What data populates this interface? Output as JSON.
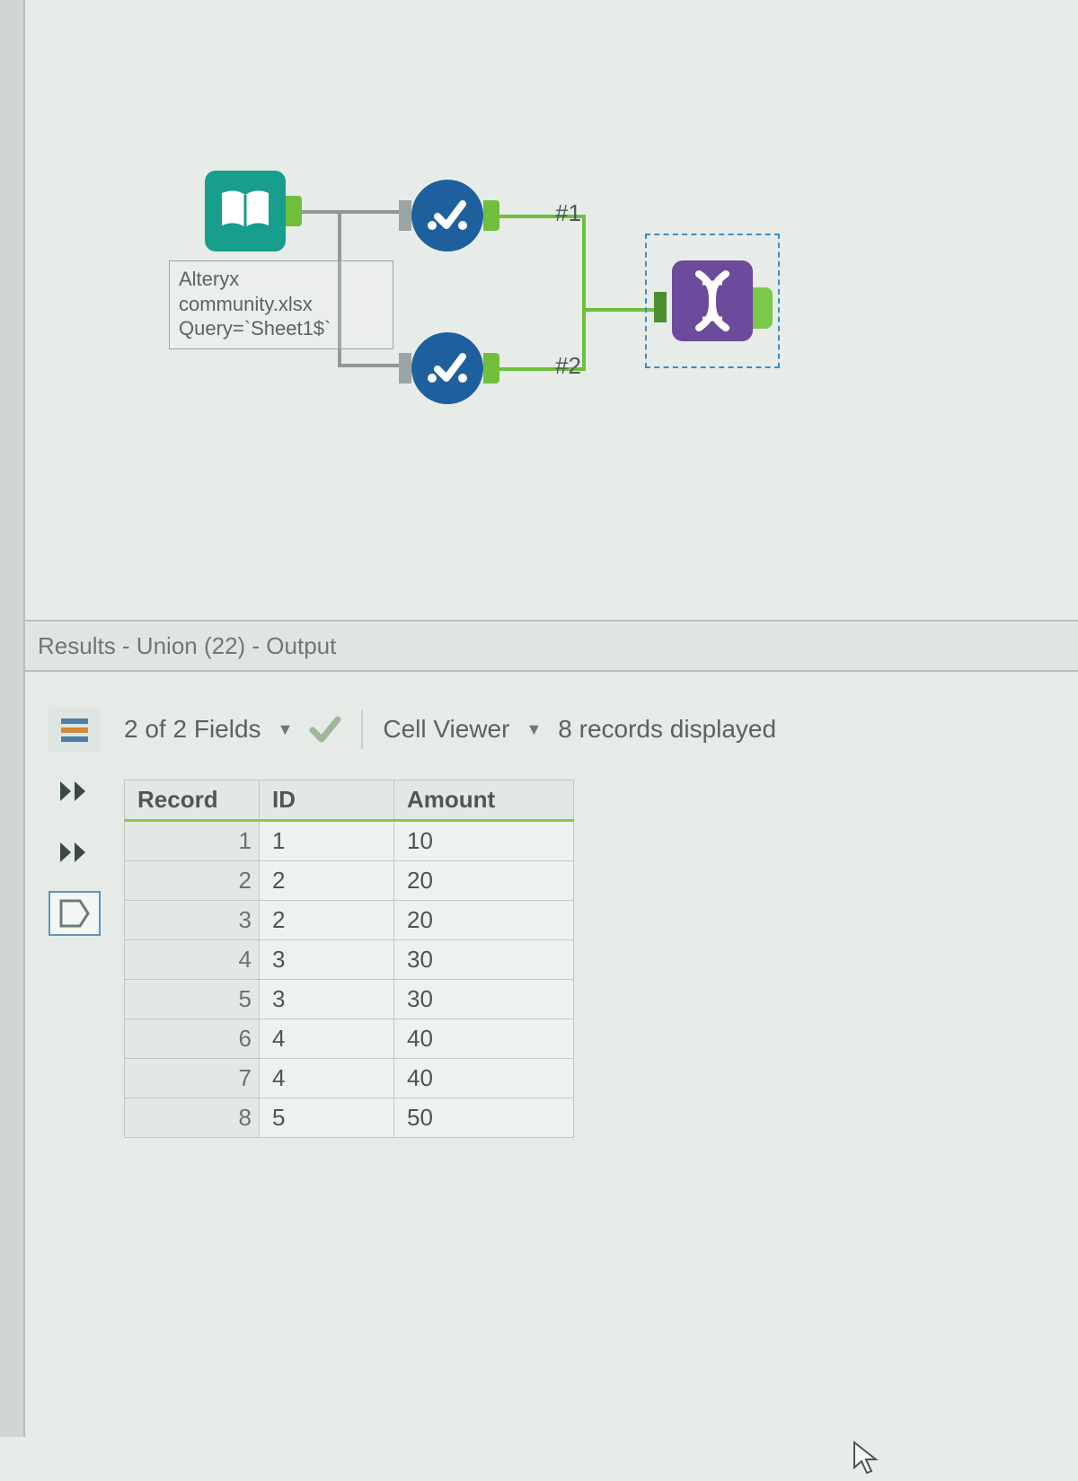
{
  "canvas": {
    "input_annotation": "Alteryx\ncommunity.xlsx\nQuery=`Sheet1$`",
    "branch1_label": "#1",
    "branch2_label": "#2"
  },
  "results": {
    "header": "Results - Union (22) - Output",
    "fields_label": "2 of 2 Fields",
    "cell_viewer_label": "Cell Viewer",
    "records_label": "8 records displayed",
    "columns": [
      "Record",
      "ID",
      "Amount"
    ],
    "rows": [
      {
        "n": "1",
        "id": "1",
        "amount": "10"
      },
      {
        "n": "2",
        "id": "2",
        "amount": "20"
      },
      {
        "n": "3",
        "id": "2",
        "amount": "20"
      },
      {
        "n": "4",
        "id": "3",
        "amount": "30"
      },
      {
        "n": "5",
        "id": "3",
        "amount": "30"
      },
      {
        "n": "6",
        "id": "4",
        "amount": "40"
      },
      {
        "n": "7",
        "id": "4",
        "amount": "40"
      },
      {
        "n": "8",
        "id": "5",
        "amount": "50"
      }
    ]
  }
}
